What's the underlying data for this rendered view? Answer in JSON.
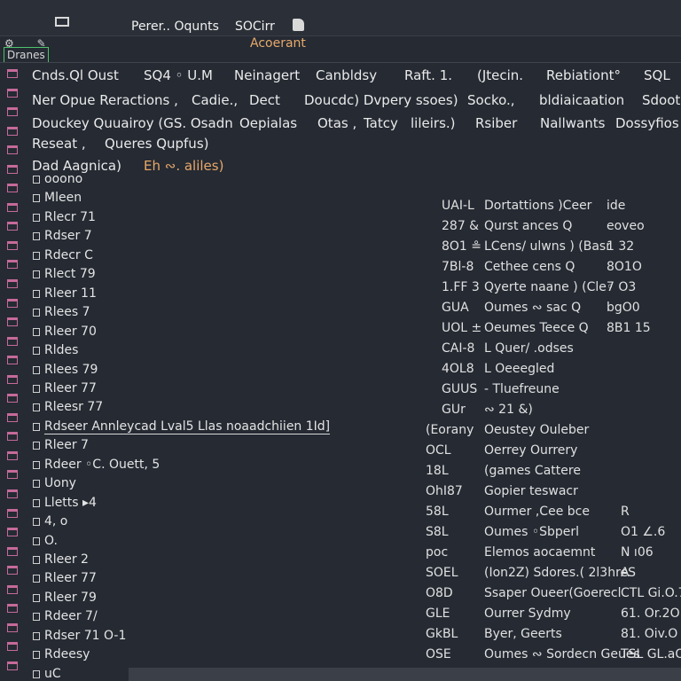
{
  "titlebar": {
    "title_left": "Perer.. Oqunts",
    "title_right": "SOCirr"
  },
  "subtitle": "Acoerant",
  "tag": "Dranes",
  "header_rows": [
    [
      "Cnds.Ql Oust",
      "SQ4 ◦ U.M",
      "Neinagert",
      "Canbldsy",
      "Raft. 1.",
      "(Jtecin.",
      "Rebiationt°",
      "SQL"
    ],
    [
      "Ner Opue Reractions ,",
      "Cadie.,",
      "Dect",
      "Doucdc) Dvpery ssoes)",
      "Socko.,",
      "bldiaicaation",
      "Sdoot"
    ],
    [
      "Douckey Quuairoy (GS. Osadn",
      "Oepialas",
      "Otas ,",
      "Tatcy",
      "lileirs.)",
      "Rsiber",
      "Nallwants",
      "Dossyfios"
    ],
    [
      "Reseat ,",
      "Queres Qupfus)"
    ],
    [
      "Dad Aagnica)",
      "Eh ∾. aliles)"
    ]
  ],
  "left_items": [
    {
      "label": "ooono"
    },
    {
      "label": "Mleen"
    },
    {
      "label": "Rlecr 71"
    },
    {
      "label": "Rdser 7"
    },
    {
      "label": "Rdecr C"
    },
    {
      "label": "Rlect 79"
    },
    {
      "label": "Rleer 11"
    },
    {
      "label": "Rlees 7"
    },
    {
      "label": "Rleer 70"
    },
    {
      "label": "Rldes"
    },
    {
      "label": "Rlees 79"
    },
    {
      "label": "Rleer 77"
    },
    {
      "label": "Rleesr 77"
    },
    {
      "label": "Rdseer Annleycad Lval5 Llas noaadchiien 1Id]"
    },
    {
      "label": "Rleer 7"
    },
    {
      "label": "Rdeer ◦C. Ouett, 5"
    },
    {
      "label": "Uony"
    },
    {
      "label": "Lletts ▸4"
    },
    {
      "label": "4, o"
    },
    {
      "label": "O."
    },
    {
      "label": "Rleer 2"
    },
    {
      "label": "Rleer 77"
    },
    {
      "label": "Rleer 79"
    },
    {
      "label": "Rdeer 7/"
    },
    {
      "label": "Rdser 71 O-1"
    },
    {
      "label": "Rdeesy"
    },
    {
      "label": "uC"
    }
  ],
  "right_items": [
    {
      "code": "UAI-L",
      "text": "Dortattions )Ceer",
      "val": "ide"
    },
    {
      "code": "287 &",
      "text": "Qurst ances Q",
      "val": "eoveo"
    },
    {
      "code": "8O1 ≗",
      "text": "LCens/ ulwns ) (Basr",
      "val": "1 32"
    },
    {
      "code": "7Bl-8",
      "text": "Cethee cens Q",
      "val": "8O1O"
    },
    {
      "code": "1.FF 3",
      "text": "Qyerte naane ) (Cle◦",
      "val": "7 O3"
    },
    {
      "code": "GUA",
      "text": "Oumes ∾ sac Q",
      "val": "bgO0"
    },
    {
      "code": "UOL ±",
      "text": "Oeumes Teece Q",
      "val": "8B1 15"
    },
    {
      "code": "CAI-8",
      "text": "L Quer/ .odses",
      "val": ""
    },
    {
      "code": "4OL8",
      "text": "L Oeeegled",
      "val": ""
    },
    {
      "code": "GUUS",
      "text": "- Tluefreune",
      "val": ""
    },
    {
      "code": "GUr",
      "text": "∾ 21 &)",
      "val": ""
    },
    {
      "code": "(Eorany",
      "text": "Oeustey  Ouleber",
      "val": ""
    },
    {
      "code": "OCL",
      "text": "Oerrey  Ourrery",
      "val": ""
    },
    {
      "code": "18L",
      "text": "(games  Cattere",
      "val": ""
    },
    {
      "code": "OhI87",
      "text": "Gopier  teswacr",
      "val": ""
    },
    {
      "code": "58L",
      "text": "Ourmer  ,Cee bce",
      "val": "R"
    },
    {
      "code": "S8L",
      "text": "Oumes  ◦Sbperl",
      "val": "O1 ∠.6"
    },
    {
      "code": "poc",
      "text": "Elemos  aocaemnt",
      "val": "N  ı06"
    },
    {
      "code": "SOEL",
      "text": "(Ion2Z)  Sdores.( 2l3hreS",
      "val": "A"
    },
    {
      "code": "O8D",
      "text": "Ssaper  Oueer(Goerecl",
      "val": "CTL Gi.O.7"
    },
    {
      "code": "GLE",
      "text": "Ourrer  Sydmy",
      "val": "61. Or.2O"
    },
    {
      "code": "GkBL",
      "text": "Byer,  Geerts",
      "val": "81. Oiv.O"
    },
    {
      "code": "OSE",
      "text": "Oumes ∾ Sordecn  Geues",
      "val": "TSL GL.aO"
    }
  ]
}
